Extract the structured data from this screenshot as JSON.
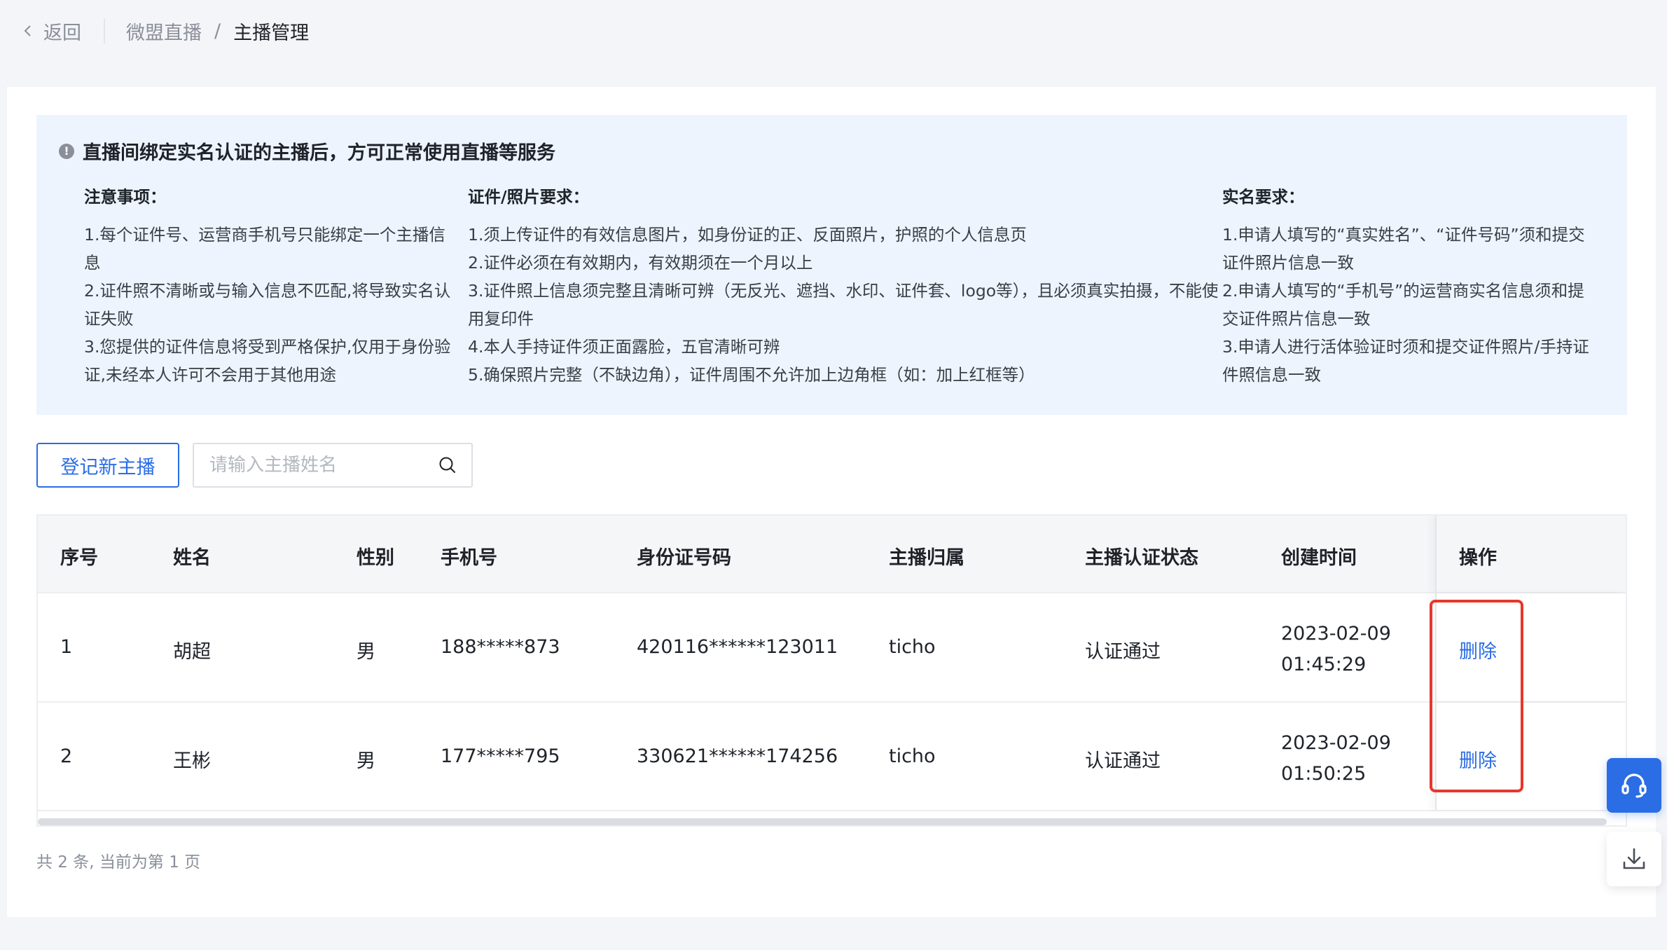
{
  "header": {
    "back_label": "返回",
    "breadcrumb_parent": "微盟直播",
    "breadcrumb_separator": "/",
    "breadcrumb_current": "主播管理"
  },
  "notice": {
    "title": "直播间绑定实名认证的主播后，方可正常使用直播等服务",
    "columns": [
      {
        "heading": "注意事项：",
        "items": [
          "1.每个证件号、运营商手机号只能绑定一个主播信息",
          "2.证件照不清晰或与输入信息不匹配,将导致实名认证失败",
          "3.您提供的证件信息将受到严格保护,仅用于身份验证,未经本人许可不会用于其他用途"
        ]
      },
      {
        "heading": "证件/照片要求：",
        "items": [
          "1.须上传证件的有效信息图片，如身份证的正、反面照片，护照的个人信息页",
          "2.证件必须在有效期内，有效期须在一个月以上",
          "3.证件照上信息须完整且清晰可辨（无反光、遮挡、水印、证件套、logo等），且必须真实拍摄，不能使用复印件",
          "4.本人手持证件须正面露脸，五官清晰可辨",
          "5.确保照片完整（不缺边角），证件周围不允许加上边角框（如：加上红框等）"
        ]
      },
      {
        "heading": "实名要求：",
        "items": [
          "1.申请人填写的“真实姓名”、“证件号码”须和提交证件照片信息一致",
          "2.申请人填写的“手机号”的运营商实名信息须和提交证件照片信息一致",
          "3.申请人进行活体验证时须和提交证件照片/手持证件照信息一致"
        ]
      }
    ]
  },
  "toolbar": {
    "register_label": "登记新主播",
    "search_placeholder": "请输入主播姓名"
  },
  "table": {
    "headers": {
      "index": "序号",
      "name": "姓名",
      "gender": "性别",
      "phone": "手机号",
      "id_number": "身份证号码",
      "owner": "主播归属",
      "status": "主播认证状态",
      "created": "创建时间",
      "actions": "操作"
    },
    "rows": [
      {
        "index": "1",
        "name": "胡超",
        "gender": "男",
        "phone": "188*****873",
        "id_number": "420116******123011",
        "owner": "ticho",
        "status": "认证通过",
        "created": "2023-02-09\n01:45:29",
        "action": "删除"
      },
      {
        "index": "2",
        "name": "王彬",
        "gender": "男",
        "phone": "177*****795",
        "id_number": "330621******174256",
        "owner": "ticho",
        "status": "认证通过",
        "created": "2023-02-09\n01:50:25",
        "action": "删除"
      }
    ]
  },
  "pagination": {
    "summary": "共 2 条, 当前为第 1 页"
  },
  "colors": {
    "accent": "#2b6de4",
    "highlight": "#e8372b",
    "notice_bg": "#edf4fd"
  },
  "icons": {
    "back": "chevron-left-icon",
    "info": "info-icon",
    "search": "search-icon",
    "support": "headset-icon",
    "download": "download-icon"
  }
}
